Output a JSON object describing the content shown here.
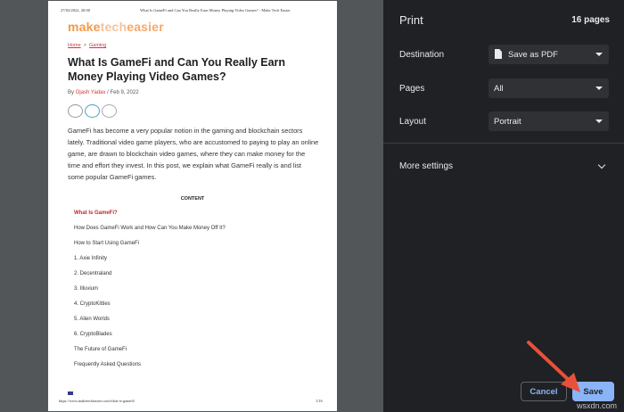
{
  "preview": {
    "header_date": "27/02/2022, 20:00",
    "header_title": "What Is GameFi and Can You Really Earn Money Playing Video Games? - Make Tech Easier",
    "logo": {
      "part1": "make",
      "part2": "tech",
      "part3": "easier"
    },
    "breadcrumb": {
      "home": "Home",
      "sep": ">",
      "section": "Gaming"
    },
    "article_title": "What Is GameFi and Can You Really Earn Money Playing Video Games?",
    "byline": {
      "by": "By",
      "author": "Ojash Yadav",
      "date": "/ Feb 9, 2022"
    },
    "intro": "GameFi has become a very popular notion in the gaming and blockchain sectors lately. Traditional video game players, who are accustomed to paying to play an online game, are drawn to blockchain video games, where they can make money for the time and effort they invest. In this post, we explain what GameFi really is and list some popular GameFi games.",
    "contents_heading": "CONTENT",
    "toc": [
      "What Is GameFi?",
      "How Does GameFi Work and How Can You Make Money Off It?",
      "How to Start Using GameFi",
      "1. Axie Infinity",
      "2. Decentraland",
      "3. Illuvium",
      "4. CryptoKitties",
      "5. Alien Worlds",
      "6. CryptoBlades",
      "The Future of GameFi",
      "Frequently Asked Questions"
    ],
    "footer_url": "https://www.maketecheasier.com/what-is-gamefi/",
    "footer_page": "1/16"
  },
  "panel": {
    "title": "Print",
    "page_count": "16 pages",
    "destination": {
      "label": "Destination",
      "value": "Save as PDF"
    },
    "pages": {
      "label": "Pages",
      "value": "All"
    },
    "layout": {
      "label": "Layout",
      "value": "Portrait"
    },
    "more_settings": "More settings",
    "cancel_label": "Cancel",
    "save_label": "Save"
  },
  "colors": {
    "panel_bg": "#202124",
    "accent": "#8ab4f8",
    "arrow": "#e8503a"
  },
  "watermark": "wsxdn.com"
}
